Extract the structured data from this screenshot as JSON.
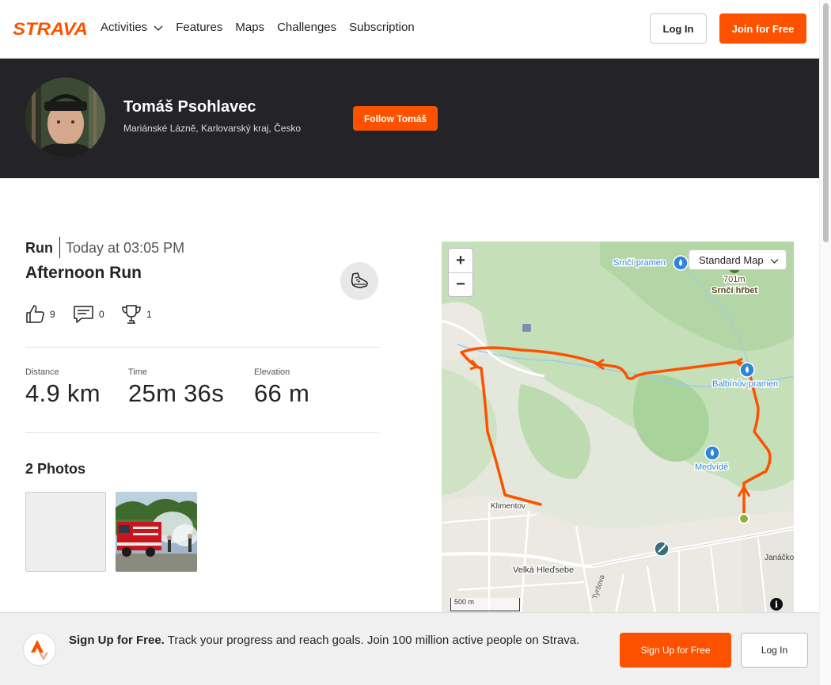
{
  "brand": {
    "logo_text": "STRAVA",
    "accent": "#fc5200",
    "dark": "#242428"
  },
  "nav": {
    "items": [
      {
        "label": "Activities"
      },
      {
        "label": "Features"
      },
      {
        "label": "Maps"
      },
      {
        "label": "Challenges"
      },
      {
        "label": "Subscription"
      }
    ],
    "login_label": "Log In",
    "join_label": "Join for Free"
  },
  "athlete": {
    "name": "Tomáš Psohlavec",
    "location": "Mariánské Lázně, Karlovarský kraj, Česko",
    "follow_label": "Follow Tomáš"
  },
  "activity": {
    "type": "Run",
    "time": "Today at 03:05 PM",
    "title": "Afternoon Run",
    "kudos": "9",
    "comments": "0",
    "achievements": "1",
    "stats": [
      {
        "label": "Distance",
        "value": "4.9 km"
      },
      {
        "label": "Time",
        "value": "25m 36s"
      },
      {
        "label": "Elevation",
        "value": "66 m"
      }
    ],
    "photos_title": "2 Photos"
  },
  "map": {
    "style_label": "Standard Map",
    "scale_label": "500 m",
    "labels": {
      "srnci_pramen": "Srnčí pramen",
      "peak_elev": "701m",
      "srnci_hrbet": "Srnčí hřbet",
      "balbinuv": "Balbínův pramen",
      "medvide": "Medvídě",
      "klimentov": "Klimentov",
      "velka_hledsebe": "Velká Hleďsebe",
      "tyrsova": "Tyršova",
      "janackova": "Janáčko"
    },
    "route_color": "#fc5200"
  },
  "banner": {
    "headline": "Sign Up for Free.",
    "text": "Track your progress and reach goals. Join 100 million active people on Strava.",
    "signup_label": "Sign Up for Free",
    "login_label": "Log In"
  }
}
